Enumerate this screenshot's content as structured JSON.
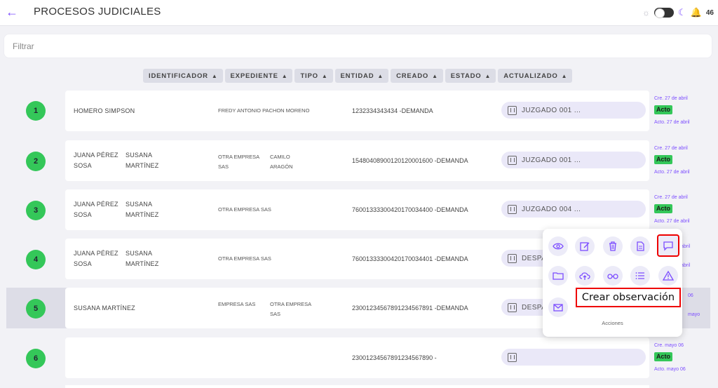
{
  "header": {
    "title": "PROCESOS JUDICIALES",
    "back_icon": "arrow-left-icon",
    "notifications_count": "46"
  },
  "filter": {
    "placeholder": "Filtrar"
  },
  "columns": [
    "IDENTIFICADOR",
    "EXPEDIENTE",
    "TIPO",
    "ENTIDAD",
    "CREADO",
    "ESTADO",
    "ACTUALIZADO"
  ],
  "rows": [
    {
      "num": "1",
      "names": [
        "HOMERO SIMPSON"
      ],
      "exp": [
        "FREDY ANTONIO PACHON MORENO"
      ],
      "ident": "1232334343434 -DEMANDA",
      "court": "JUZGADO 001 ...",
      "created": "Cre. 27 de abril",
      "state": "Acto",
      "updated": "Acto. 27 de abril"
    },
    {
      "num": "2",
      "names": [
        "JUANA PÉREZ SOSA",
        "SUSANA MARTÍNEZ"
      ],
      "exp": [
        "OTRA EMPRESA SAS",
        "CAMILO ARAGÓN"
      ],
      "ident": "15480408900120120001600 -DEMANDA",
      "court": "JUZGADO 001 ...",
      "created": "Cre. 27 de abril",
      "state": "Acto",
      "updated": "Acto. 27 de abril"
    },
    {
      "num": "3",
      "names": [
        "JUANA PÉREZ SOSA",
        "SUSANA MARTÍNEZ"
      ],
      "exp": [
        "OTRA EMPRESA SAS"
      ],
      "ident": "76001333300420170034400 -DEMANDA",
      "court": "JUZGADO 004 ...",
      "created": "Cre. 27 de abril",
      "state": "Acto",
      "updated": "Acto. 27 de abril"
    },
    {
      "num": "4",
      "names": [
        "JUANA PÉREZ SOSA",
        "SUSANA MARTÍNEZ"
      ],
      "exp": [
        "OTRA EMPRESA SAS"
      ],
      "ident": "76001333300420170034401 -DEMANDA",
      "court": "DESPA",
      "created": "abril",
      "state": "",
      "updated": "abril"
    },
    {
      "num": "5",
      "names": [
        "SUSANA MARTÍNEZ"
      ],
      "exp": [
        "EMPRESA SAS",
        "OTRA EMPRESA SAS"
      ],
      "ident": "23001234567891234567891 -DEMANDA",
      "court": "DESPA",
      "created": "06",
      "state": "",
      "updated": "mayo"
    },
    {
      "num": "6",
      "names": [],
      "exp": [],
      "ident": "23001234567891234567890 -",
      "court": "",
      "created": "Cre. mayo 06",
      "state": "Acto",
      "updated": "Acto. mayo 06"
    }
  ],
  "actions_popup": {
    "tooltip": "Crear observación",
    "label": "Acciones",
    "icons": [
      "eye-icon",
      "edit-icon",
      "trash-icon",
      "document-icon",
      "comment-icon",
      "folder-icon",
      "cloud-upload-icon",
      "glasses-icon",
      "list-icon",
      "warning-icon",
      "mail-icon"
    ]
  }
}
